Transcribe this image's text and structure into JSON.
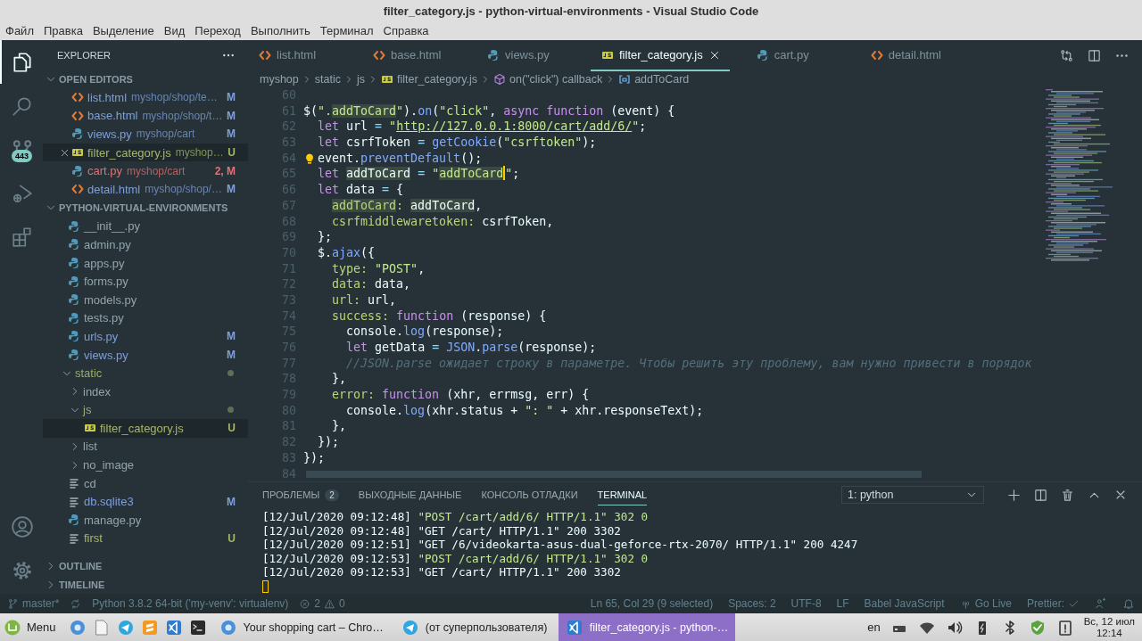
{
  "window": {
    "title": "filter_category.js - python-virtual-environments - Visual Studio Code"
  },
  "menu": [
    "Файл",
    "Правка",
    "Выделение",
    "Вид",
    "Переход",
    "Выполнить",
    "Терминал",
    "Справка"
  ],
  "activity_bar": {
    "items": [
      {
        "kind": "explorer",
        "selected": true
      },
      {
        "kind": "search",
        "selected": false
      },
      {
        "kind": "source-control",
        "selected": false,
        "badge": "443"
      },
      {
        "kind": "run",
        "selected": false
      },
      {
        "kind": "extensions",
        "selected": false
      }
    ],
    "bottom": [
      {
        "kind": "account"
      },
      {
        "kind": "settings"
      }
    ]
  },
  "sidebar": {
    "title": "EXPLORER",
    "open_editors": {
      "label": "OPEN EDITORS",
      "expanded": true,
      "items": [
        {
          "name": "list.html",
          "path": "myshop/shop/te…",
          "kind": "html",
          "status": "M",
          "color": "#7e9fdb",
          "selected": false
        },
        {
          "name": "base.html",
          "path": "myshop/shop/t…",
          "kind": "html",
          "status": "M",
          "color": "#7e9fdb",
          "selected": false
        },
        {
          "name": "views.py",
          "path": "myshop/cart",
          "kind": "py",
          "status": "M",
          "color": "#7e9fdb",
          "selected": false
        },
        {
          "name": "filter_category.js",
          "path": "myshop…",
          "kind": "js",
          "status": "U",
          "color": "#a7b768",
          "selected": true
        },
        {
          "name": "cart.py",
          "path": "myshop/cart",
          "kind": "py",
          "status": "2, M",
          "color": "#e86f6f",
          "selected": false
        },
        {
          "name": "detail.html",
          "path": "myshop/shop/…",
          "kind": "html",
          "status": "M",
          "color": "#7e9fdb",
          "selected": false
        }
      ]
    },
    "folder": {
      "label": "PYTHON-VIRTUAL-ENVIRONMENTS",
      "expanded": true,
      "items": [
        {
          "name": "__init__.py",
          "kind": "py",
          "selected": false
        },
        {
          "name": "admin.py",
          "kind": "py",
          "selected": false
        },
        {
          "name": "apps.py",
          "kind": "py",
          "selected": false
        },
        {
          "name": "forms.py",
          "kind": "py",
          "selected": false
        },
        {
          "name": "models.py",
          "kind": "py",
          "selected": false
        },
        {
          "name": "tests.py",
          "kind": "py",
          "selected": false
        },
        {
          "name": "urls.py",
          "kind": "py",
          "status": "M",
          "color": "#7e9fdb",
          "selected": false
        },
        {
          "name": "views.py",
          "kind": "py",
          "status": "M",
          "color": "#7e9fdb",
          "selected": false
        },
        {
          "name": "static",
          "kind": "folder",
          "color": "#9aab72",
          "dot": true,
          "expanded": true,
          "selected": false,
          "children": [
            {
              "name": "index",
              "kind": "folder",
              "dot": false,
              "expanded": false,
              "selected": false
            },
            {
              "name": "js",
              "kind": "folder",
              "color": "#9aab72",
              "dot": true,
              "expanded": true,
              "selected": false,
              "children": [
                {
                  "name": "filter_category.js",
                  "kind": "js",
                  "status": "U",
                  "color": "#a7b768",
                  "selected": true
                }
              ]
            },
            {
              "name": "list",
              "kind": "folder",
              "dot": false,
              "expanded": false,
              "selected": false
            },
            {
              "name": "no_image",
              "kind": "folder",
              "dot": false,
              "expanded": false,
              "selected": false
            }
          ]
        },
        {
          "name": "cd",
          "kind": "text",
          "selected": false
        },
        {
          "name": "db.sqlite3",
          "kind": "text",
          "status": "M",
          "color": "#7e9fdb",
          "selected": false
        },
        {
          "name": "manage.py",
          "kind": "py",
          "selected": false
        },
        {
          "name": "first",
          "kind": "text",
          "status": "U",
          "color": "#a7b768",
          "selected": false
        }
      ]
    },
    "sections": [
      {
        "label": "OUTLINE",
        "expanded": false
      },
      {
        "label": "TIMELINE",
        "expanded": false
      }
    ]
  },
  "editor": {
    "tabs": [
      {
        "label": "list.html",
        "kind": "html",
        "selected": false
      },
      {
        "label": "base.html",
        "kind": "html",
        "selected": false
      },
      {
        "label": "views.py",
        "kind": "py",
        "selected": false
      },
      {
        "label": "filter_category.js",
        "kind": "js",
        "selected": true
      },
      {
        "label": "cart.py",
        "kind": "py",
        "selected": false
      },
      {
        "label": "detail.html",
        "kind": "html",
        "selected": false
      }
    ],
    "breadcrumbs": [
      {
        "label": "myshop",
        "kind": "folder"
      },
      {
        "label": "static",
        "kind": "folder"
      },
      {
        "label": "js",
        "kind": "folder"
      },
      {
        "label": "filter_category.js",
        "kind": "js"
      },
      {
        "label": "on(\"click\") callback",
        "kind": "method"
      },
      {
        "label": "addToCard",
        "kind": "variable"
      }
    ],
    "lines": [
      {
        "number": "60"
      },
      {
        "number": "61",
        "tokens": [
          {
            "text": "$(",
            "kind": "plain"
          },
          {
            "text": "\".",
            "kind": "string"
          },
          {
            "text": "addToCard",
            "kind": "string-match"
          },
          {
            "text": "\"",
            "kind": "string"
          },
          {
            "text": ").",
            "kind": "plain"
          },
          {
            "text": "on",
            "kind": "func"
          },
          {
            "text": "(",
            "kind": "plain"
          },
          {
            "text": "\"click\"",
            "kind": "string"
          },
          {
            "text": ", ",
            "kind": "plain"
          },
          {
            "text": "async function",
            "kind": "keyword"
          },
          {
            "text": " (event) {",
            "kind": "plain"
          }
        ]
      },
      {
        "number": "62",
        "tokens": [
          {
            "text": "  let",
            "kind": "keyword"
          },
          {
            "text": " url ",
            "kind": "plain"
          },
          {
            "text": "= ",
            "kind": "op"
          },
          {
            "text": "\"",
            "kind": "string"
          },
          {
            "text": "http://127.0.0.1:8000/cart/add/6/",
            "kind": "link"
          },
          {
            "text": "\"",
            "kind": "string"
          },
          {
            "text": ";",
            "kind": "plain"
          }
        ]
      },
      {
        "number": "63",
        "tokens": [
          {
            "text": "  let",
            "kind": "keyword"
          },
          {
            "text": " csrfToken ",
            "kind": "plain"
          },
          {
            "text": "= ",
            "kind": "op"
          },
          {
            "text": "getCookie",
            "kind": "func"
          },
          {
            "text": "(",
            "kind": "plain"
          },
          {
            "text": "\"csrftoken\"",
            "kind": "string"
          },
          {
            "text": ");",
            "kind": "plain"
          }
        ]
      },
      {
        "number": "64",
        "tokens": [
          {
            "kind": "lightbulb"
          },
          {
            "text": "event.",
            "kind": "plain"
          },
          {
            "text": "preventDefault",
            "kind": "func"
          },
          {
            "text": "();",
            "kind": "plain"
          }
        ]
      },
      {
        "number": "65",
        "tokens": [
          {
            "text": "  let ",
            "kind": "keyword"
          },
          {
            "text": "addToCard",
            "kind": "plain-match"
          },
          {
            "text": " = ",
            "kind": "op"
          },
          {
            "text": "\"",
            "kind": "string"
          },
          {
            "text": "addToCard",
            "kind": "string-match"
          },
          {
            "kind": "cursor"
          },
          {
            "text": "\"",
            "kind": "string"
          },
          {
            "text": ";",
            "kind": "plain"
          }
        ]
      },
      {
        "number": "66",
        "tokens": [
          {
            "text": "  let",
            "kind": "keyword"
          },
          {
            "text": " data ",
            "kind": "plain"
          },
          {
            "text": "= ",
            "kind": "op"
          },
          {
            "text": "{",
            "kind": "plain"
          }
        ]
      },
      {
        "number": "67",
        "tokens": [
          {
            "text": "    addToCard",
            "kind": "prop-match"
          },
          {
            "text": ": ",
            "kind": "prop"
          },
          {
            "text": "addToCard",
            "kind": "plain-match"
          },
          {
            "text": ",",
            "kind": "plain"
          }
        ]
      },
      {
        "number": "68",
        "tokens": [
          {
            "text": "    csrfmiddlewaretoken: ",
            "kind": "prop"
          },
          {
            "text": "csrfToken,",
            "kind": "plain"
          }
        ]
      },
      {
        "number": "69",
        "tokens": [
          {
            "text": "  };",
            "kind": "plain"
          }
        ]
      },
      {
        "number": "70",
        "tokens": [
          {
            "text": "  $.",
            "kind": "plain"
          },
          {
            "text": "ajax",
            "kind": "func"
          },
          {
            "text": "({",
            "kind": "plain"
          }
        ]
      },
      {
        "number": "71",
        "tokens": [
          {
            "text": "    type: ",
            "kind": "prop"
          },
          {
            "text": "\"POST\"",
            "kind": "string"
          },
          {
            "text": ",",
            "kind": "plain"
          }
        ]
      },
      {
        "number": "72",
        "tokens": [
          {
            "text": "    data: ",
            "kind": "prop"
          },
          {
            "text": "data,",
            "kind": "plain"
          }
        ]
      },
      {
        "number": "73",
        "tokens": [
          {
            "text": "    url: ",
            "kind": "prop"
          },
          {
            "text": "url,",
            "kind": "plain"
          }
        ]
      },
      {
        "number": "74",
        "tokens": [
          {
            "text": "    success: ",
            "kind": "prop"
          },
          {
            "text": "function",
            "kind": "keyword"
          },
          {
            "text": " (response) {",
            "kind": "plain"
          }
        ]
      },
      {
        "number": "75",
        "tokens": [
          {
            "text": "      console.",
            "kind": "plain"
          },
          {
            "text": "log",
            "kind": "func"
          },
          {
            "text": "(response);",
            "kind": "plain"
          }
        ]
      },
      {
        "number": "76",
        "tokens": [
          {
            "text": "      let",
            "kind": "keyword"
          },
          {
            "text": " getData ",
            "kind": "plain"
          },
          {
            "text": "= ",
            "kind": "op"
          },
          {
            "text": "JSON",
            "kind": "func"
          },
          {
            "text": ".",
            "kind": "plain"
          },
          {
            "text": "parse",
            "kind": "func"
          },
          {
            "text": "(response);",
            "kind": "plain"
          }
        ]
      },
      {
        "number": "77",
        "tokens": [
          {
            "text": "      //JSON.parse ожидает строку в параметре. Чтобы решить эту проблему, вам нужно привести в порядок",
            "kind": "comment"
          }
        ]
      },
      {
        "number": "78",
        "tokens": [
          {
            "text": "    },",
            "kind": "plain"
          }
        ]
      },
      {
        "number": "79",
        "tokens": [
          {
            "text": "    error: ",
            "kind": "prop"
          },
          {
            "text": "function",
            "kind": "keyword"
          },
          {
            "text": " (xhr, errmsg, err) {",
            "kind": "plain"
          }
        ]
      },
      {
        "number": "80",
        "tokens": [
          {
            "text": "      console.",
            "kind": "plain"
          },
          {
            "text": "log",
            "kind": "func"
          },
          {
            "text": "(xhr.status + ",
            "kind": "plain"
          },
          {
            "text": "\": \"",
            "kind": "string"
          },
          {
            "text": " + xhr.responseText);",
            "kind": "plain"
          }
        ]
      },
      {
        "number": "81",
        "tokens": [
          {
            "text": "    },",
            "kind": "plain"
          }
        ]
      },
      {
        "number": "82",
        "tokens": [
          {
            "text": "  });",
            "kind": "plain"
          }
        ]
      },
      {
        "number": "83",
        "tokens": [
          {
            "text": "});",
            "kind": "plain"
          }
        ]
      },
      {
        "number": "84"
      }
    ]
  },
  "panel": {
    "tabs": [
      {
        "label": "ПРОБЛЕМЫ",
        "badge": "2",
        "selected": false
      },
      {
        "label": "ВЫХОДНЫЕ ДАННЫЕ",
        "selected": false
      },
      {
        "label": "КОНСОЛЬ ОТЛАДКИ",
        "selected": false
      },
      {
        "label": "TERMINAL",
        "selected": true
      }
    ],
    "terminal_picker": {
      "value": "1: python"
    },
    "terminal": [
      {
        "time": "[12/Jul/2020 09:12:48]",
        "request": "\"POST /cart/add/6/ HTTP/1.1\" 302 0",
        "kind": "redirect"
      },
      {
        "time": "[12/Jul/2020 09:12:48]",
        "request": "\"GET /cart/ HTTP/1.1\" 200 3302",
        "kind": "ok"
      },
      {
        "time": "[12/Jul/2020 09:12:51]",
        "request": "\"GET /6/videokarta-asus-dual-geforce-rtx-2070/ HTTP/1.1\" 200 4247",
        "kind": "ok"
      },
      {
        "time": "[12/Jul/2020 09:12:53]",
        "request": "\"POST /cart/add/6/ HTTP/1.1\" 302 0",
        "kind": "redirect"
      },
      {
        "time": "[12/Jul/2020 09:12:53]",
        "request": "\"GET /cart/ HTTP/1.1\" 200 3302",
        "kind": "ok"
      }
    ]
  },
  "status_bar": {
    "left": [
      {
        "kind": "branch",
        "text": "master*"
      },
      {
        "kind": "sync"
      },
      {
        "kind": "text",
        "text": "Python 3.8.2 64-bit ('my-venv': virtualenv)"
      },
      {
        "kind": "problems",
        "errors": "2",
        "warnings": "0"
      }
    ],
    "right": [
      {
        "kind": "text",
        "text": "Ln 65, Col 29 (9 selected)"
      },
      {
        "kind": "text",
        "text": "Spaces: 2"
      },
      {
        "kind": "text",
        "text": "UTF-8"
      },
      {
        "kind": "text",
        "text": "LF"
      },
      {
        "kind": "text",
        "text": "Babel JavaScript"
      },
      {
        "kind": "live",
        "text": "Go Live"
      },
      {
        "kind": "prettier",
        "text": "Prettier:"
      },
      {
        "kind": "feedback"
      },
      {
        "kind": "bell"
      }
    ]
  },
  "taskbar": {
    "menu": "Menu",
    "launchers": [
      {
        "kind": "browser"
      },
      {
        "kind": "files"
      },
      {
        "kind": "telegram"
      },
      {
        "kind": "sublime"
      },
      {
        "kind": "vscode"
      },
      {
        "kind": "terminal"
      }
    ],
    "windows": [
      {
        "label": "Your shopping cart – Chro…",
        "kind": "browser",
        "selected": false
      },
      {
        "label": "(от суперпользователя)",
        "kind": "telegram",
        "selected": false
      },
      {
        "label": "filter_category.js - python-…",
        "kind": "vscode",
        "selected": true
      }
    ],
    "keyboard": "en",
    "tray": [
      {
        "kind": "network"
      },
      {
        "kind": "wifi"
      },
      {
        "kind": "volume"
      },
      {
        "kind": "battery"
      },
      {
        "kind": "bluetooth"
      },
      {
        "kind": "shield"
      },
      {
        "kind": "clipboard"
      }
    ],
    "clock": {
      "date": "Вс, 12 июл",
      "time": "12:14"
    }
  }
}
